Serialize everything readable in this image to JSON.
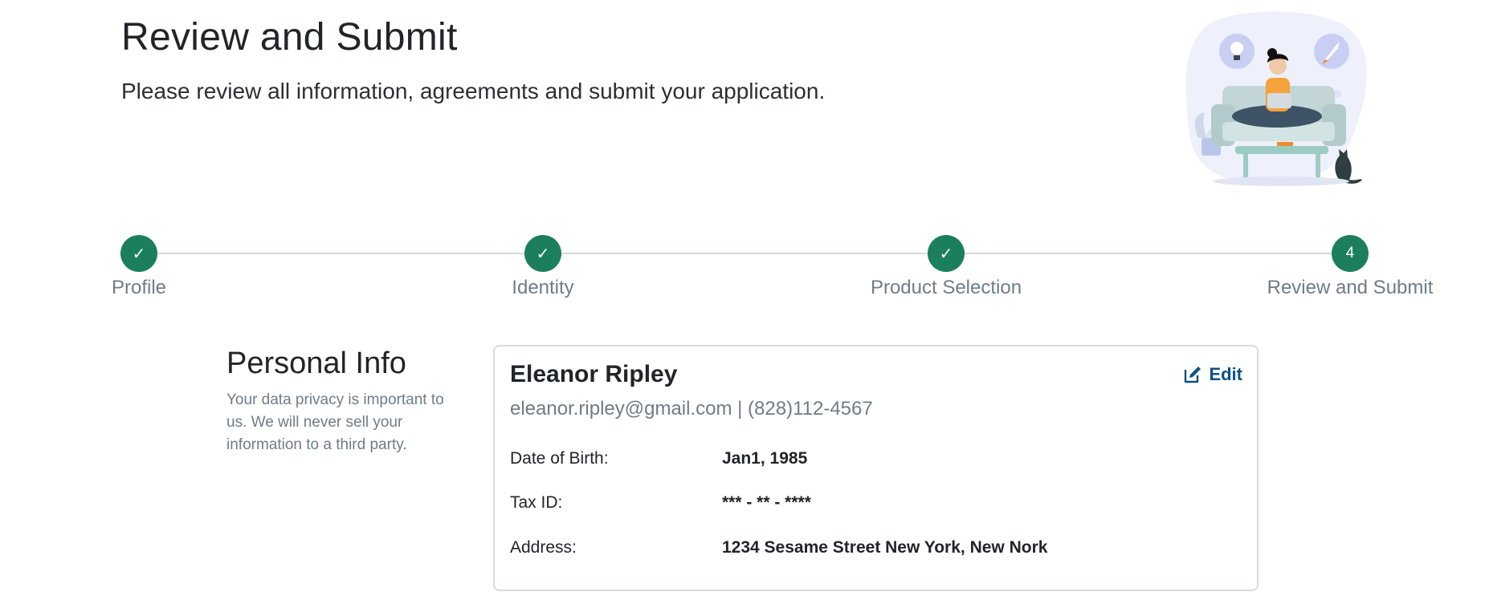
{
  "header": {
    "title": "Review and Submit",
    "subtitle": "Please review all information, agreements and submit your application."
  },
  "illustration": {
    "icon": "person-on-couch-with-laptop-illustration"
  },
  "stepper": {
    "steps": [
      {
        "label": "Profile",
        "marker": "✓",
        "status": "complete"
      },
      {
        "label": "Identity",
        "marker": "✓",
        "status": "complete"
      },
      {
        "label": "Product Selection",
        "marker": "✓",
        "status": "complete"
      },
      {
        "label": "Review and Submit",
        "marker": "4",
        "status": "current"
      }
    ]
  },
  "personal_info": {
    "title": "Personal Info",
    "description": "Your data privacy is important to us. We will never sell your information to a third party.",
    "name": "Eleanor Ripley",
    "contact": "eleanor.ripley@gmail.com | (828)112-4567",
    "edit_label": "Edit",
    "fields": [
      {
        "label": "Date of Birth:",
        "value": "Jan1, 1985"
      },
      {
        "label": "Tax ID:",
        "value": "*** - ** - ****"
      },
      {
        "label": "Address:",
        "value": "1234 Sesame Street New York, New Nork"
      }
    ]
  },
  "colors": {
    "step_green": "#1b7f5c",
    "edit_blue": "#0d4f86",
    "muted_text": "#6f7c88"
  }
}
